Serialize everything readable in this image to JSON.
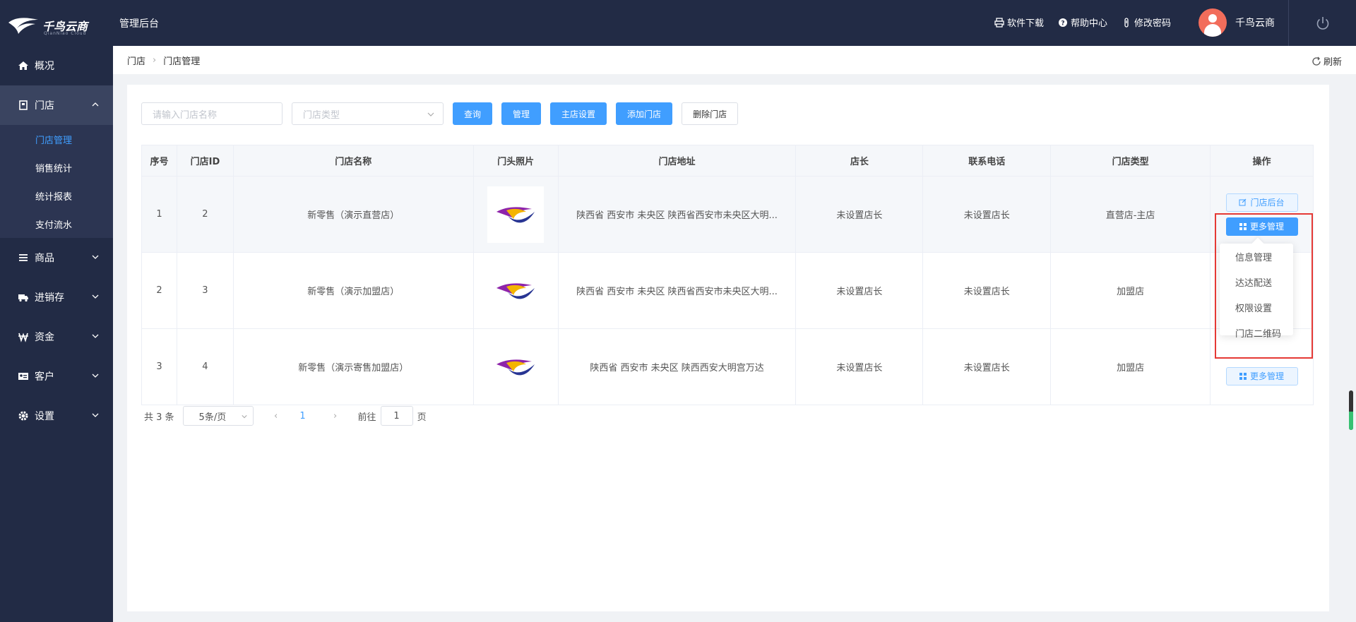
{
  "header": {
    "logo_text": "千鸟云商",
    "logo_sub": "QianNiao Cloud",
    "admin_title": "管理后台",
    "links": [
      {
        "label": "软件下载",
        "icon": "printer-icon"
      },
      {
        "label": "帮助中心",
        "icon": "help-icon"
      },
      {
        "label": "修改密码",
        "icon": "key-icon"
      }
    ],
    "user_name": "千鸟云商"
  },
  "sidebar": {
    "items": [
      {
        "label": "概况",
        "icon": "home-icon"
      },
      {
        "label": "门店",
        "icon": "store-icon"
      },
      {
        "label": "商品",
        "icon": "list-icon"
      },
      {
        "label": "进销存",
        "icon": "truck-icon"
      },
      {
        "label": "资金",
        "icon": "currency-icon"
      },
      {
        "label": "客户",
        "icon": "id-card-icon"
      },
      {
        "label": "设置",
        "icon": "gear-icon"
      }
    ],
    "store_submenu": [
      "门店管理",
      "销售统计",
      "统计报表",
      "支付流水"
    ]
  },
  "breadcrumb": {
    "root": "门店",
    "current": "门店管理",
    "refresh_label": "刷新"
  },
  "filters": {
    "name_placeholder": "请输入门店名称",
    "type_placeholder": "门店类型",
    "buttons": {
      "query": "查询",
      "manage": "管理",
      "main_store": "主店设置",
      "add_store": "添加门店",
      "delete_store": "删除门店"
    }
  },
  "table": {
    "headers": [
      "序号",
      "门店ID",
      "门店名称",
      "门头照片",
      "门店地址",
      "店长",
      "联系电话",
      "门店类型",
      "操作"
    ],
    "rows": [
      {
        "index": "1",
        "id": "2",
        "name": "新零售（演示直营店）",
        "address": "陕西省 西安市 未央区 陕西省西安市未央区大明...",
        "manager": "未设置店长",
        "phone": "未设置店长",
        "type": "直营店-主店"
      },
      {
        "index": "2",
        "id": "3",
        "name": "新零售（演示加盟店）",
        "address": "陕西省 西安市 未央区 陕西省西安市未央区大明...",
        "manager": "未设置店长",
        "phone": "未设置店长",
        "type": "加盟店"
      },
      {
        "index": "3",
        "id": "4",
        "name": "新零售（演示寄售加盟店）",
        "address": "陕西省 西安市 未央区 陕西西安大明宫万达",
        "manager": "未设置店长",
        "phone": "未设置店长",
        "type": "加盟店"
      }
    ],
    "op_store_backend": "门店后台",
    "op_more": "更多管理"
  },
  "dropdown": {
    "items": [
      "信息管理",
      "达达配送",
      "权限设置",
      "门店二维码"
    ]
  },
  "pagination": {
    "total": "共 3 条",
    "page_size": "5条/页",
    "current_page": "1",
    "goto_prefix": "前往",
    "goto_value": "1",
    "goto_suffix": "页"
  },
  "colors": {
    "nav_bg": "#222b45",
    "accent": "#409eff",
    "highlight": "#e53935"
  }
}
